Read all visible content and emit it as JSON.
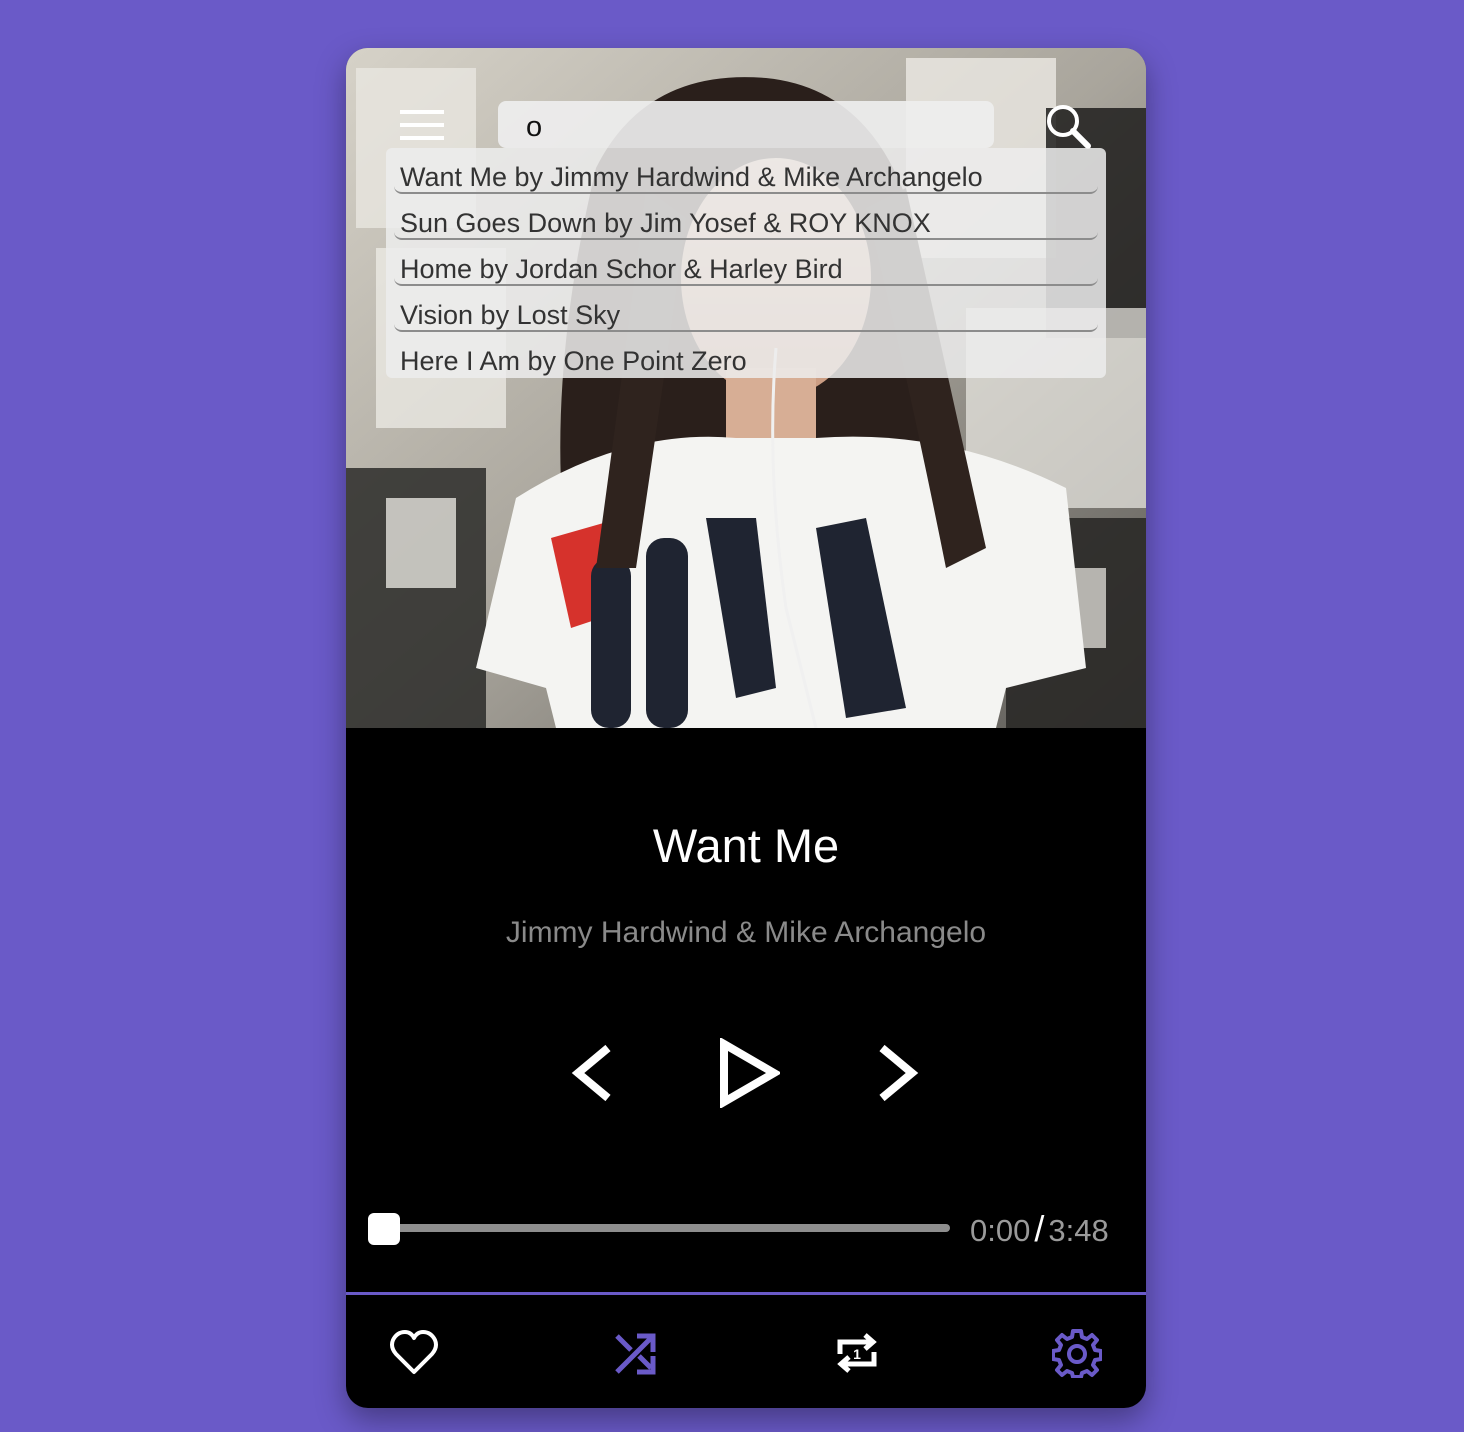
{
  "search": {
    "query": "o"
  },
  "suggestions": [
    "Want Me by Jimmy Hardwind & Mike Archangelo",
    "Sun Goes Down by Jim Yosef & ROY KNOX",
    "Home by Jordan Schor & Harley Bird",
    "Vision by Lost Sky",
    "Here I Am by One Point Zero"
  ],
  "track": {
    "title": "Want Me",
    "artist": "Jimmy Hardwind & Mike Archangelo"
  },
  "progress": {
    "current": "0:00",
    "separator": "/",
    "duration": "3:48",
    "fraction": 0.0
  },
  "colors": {
    "background": "#6a5ac8",
    "accent": "#6a5ac8",
    "player": "#000000",
    "artist_text": "#8a8a8a"
  },
  "icons": {
    "menu": "hamburger-icon",
    "search": "search-icon",
    "prev": "chevron-left-icon",
    "play": "play-icon",
    "next": "chevron-right-icon",
    "favorite": "heart-icon",
    "shuffle": "shuffle-icon",
    "repeat": "repeat-one-icon",
    "settings": "gear-icon"
  }
}
